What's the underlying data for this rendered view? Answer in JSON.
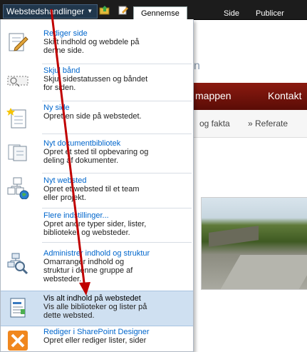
{
  "ribbon": {
    "site_actions": "Webstedshandlinger",
    "tabs": [
      "Gennemse",
      "Side",
      "Publicer"
    ]
  },
  "page": {
    "title_fragment": "n",
    "topnav": [
      "mappen",
      "Kontakt"
    ],
    "subnav": [
      "og fakta",
      "» Referate"
    ]
  },
  "menu": {
    "items": [
      {
        "title": "Rediger side",
        "desc": [
          "Skift indhold og webdele på",
          "denne side."
        ],
        "icon": "edit-page-icon"
      },
      {
        "title": "Skjul bånd",
        "desc": [
          "Skjul sidestatussen og båndet",
          "for siden."
        ],
        "icon": "hide-ribbon-icon"
      },
      {
        "title": "Ny side",
        "desc": [
          "Opret en side på webstedet."
        ],
        "icon": "new-page-icon"
      },
      {
        "title": "Nyt dokumentbibliotek",
        "desc": [
          "Opret et sted til opbevaring og",
          "deling af dokumenter."
        ],
        "icon": "document-library-icon"
      },
      {
        "title": "Nyt websted",
        "desc": [
          "Opret et websted til et team",
          "eller projekt."
        ],
        "icon": "new-site-icon"
      },
      {
        "title": "Flere indstillinger...",
        "desc": [
          "Opret andre typer sider, lister,",
          "biblioteker og websteder."
        ],
        "icon": ""
      },
      {
        "title": "Administrer indhold og struktur",
        "desc": [
          "Omarranger indhold og",
          "struktur i denne gruppe af",
          "websteder."
        ],
        "icon": "manage-content-icon"
      },
      {
        "title": "Vis alt indhold på webstedet",
        "desc": [
          "Vis alle biblioteker og lister på",
          "dette websted."
        ],
        "icon": "view-all-content-icon"
      },
      {
        "title": "Rediger i SharePoint Designer",
        "desc": [
          "Opret eller rediger lister, sider"
        ],
        "icon": "sharepoint-designer-icon"
      }
    ]
  },
  "colors": {
    "ribbon_bg": "#1c1c1c",
    "link": "#0066cc",
    "highlight": "#cfe0f1",
    "annotation_arrow": "#c00000",
    "topnav_bg": "#8b1a10"
  }
}
